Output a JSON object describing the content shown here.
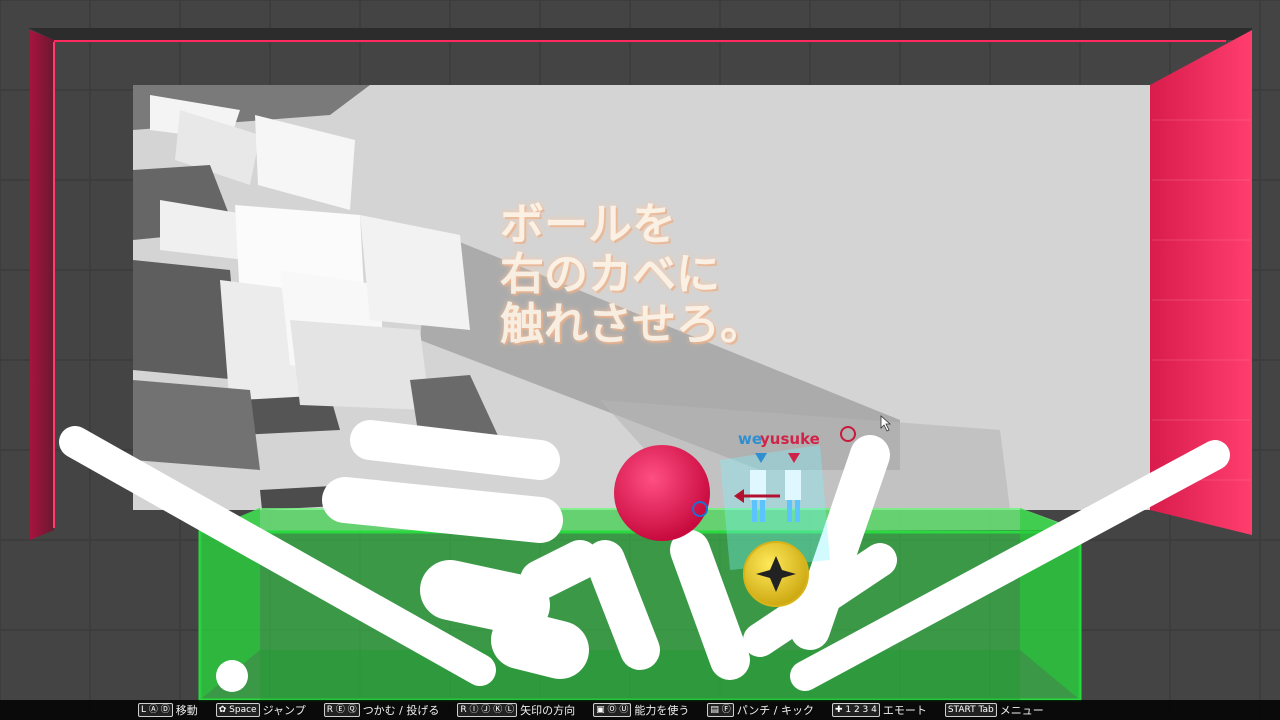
{
  "objective": {
    "line1": "ボールを",
    "line2": "右のカベに",
    "line3": "触れさせろ。"
  },
  "players": [
    {
      "name": "we",
      "color": "#2f8fd0"
    },
    {
      "name": "yusuke",
      "color": "#d0234a"
    }
  ],
  "controls": [
    {
      "keys": "L Ⓐ Ⓓ",
      "label": "移動"
    },
    {
      "keys": "✿ Space",
      "label": "ジャンプ"
    },
    {
      "keys": "R Ⓔ Ⓠ",
      "label": "つかむ / 投げる"
    },
    {
      "keys": "R Ⓘ Ⓙ Ⓚ Ⓛ",
      "label": "矢印の方向"
    },
    {
      "keys": "▣ Ⓞ Ⓤ",
      "label": "能力を使う"
    },
    {
      "keys": "▤ Ⓕ",
      "label": "パンチ / キック"
    },
    {
      "keys": "✚ 1 2 3 4",
      "label": "エモート"
    },
    {
      "keys": "START Tab",
      "label": "メニュー"
    }
  ],
  "colors": {
    "left_wall": "#b0154a",
    "right_wall": "#ff2b5e",
    "goal_zone": "#38e84e",
    "ball": "#e5124f",
    "coin": "#f1d21a",
    "backdrop": "#d2d2d2"
  }
}
